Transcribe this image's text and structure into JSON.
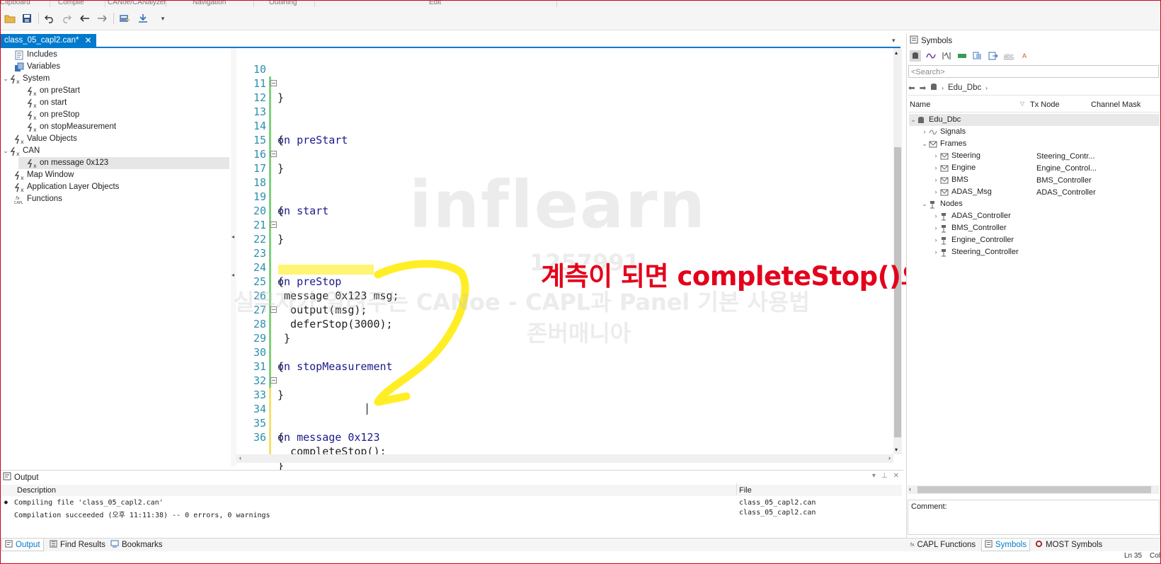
{
  "ribbon": {
    "groups": [
      "Clipboard",
      "Compile",
      "CANoe/CANalyzer",
      "Navigation",
      "Outlining",
      "Edit"
    ]
  },
  "toolbar": {
    "buttons": [
      "open-folder-icon",
      "save-icon",
      "undo-icon",
      "redo-icon",
      "back-icon",
      "forward-icon",
      "insert-icon",
      "download-icon",
      "overflow-icon"
    ]
  },
  "document_tab": {
    "label": "class_05_capl2.can*",
    "close": "✕"
  },
  "tree": {
    "items": [
      {
        "label": "Includes",
        "icon": "includes-icon"
      },
      {
        "label": "Variables",
        "icon": "variables-icon"
      },
      {
        "label": "System",
        "icon": "function-icon",
        "expanded": true
      },
      {
        "label": "on preStart",
        "icon": "function-icon"
      },
      {
        "label": "on start",
        "icon": "function-icon"
      },
      {
        "label": "on preStop",
        "icon": "function-icon"
      },
      {
        "label": "on stopMeasurement",
        "icon": "function-icon"
      },
      {
        "label": "Value Objects",
        "icon": "function-icon"
      },
      {
        "label": "CAN",
        "icon": "function-icon",
        "expanded": true
      },
      {
        "label": "on message 0x123",
        "icon": "function-icon",
        "selected": true
      },
      {
        "label": "Map Window",
        "icon": "function-icon"
      },
      {
        "label": "Application Layer Objects",
        "icon": "function-icon"
      },
      {
        "label": "Functions",
        "icon": "capl-icon"
      }
    ]
  },
  "editor": {
    "lines": [
      {
        "n": "10",
        "text": "}"
      },
      {
        "n": "11",
        "text": ""
      },
      {
        "n": "12",
        "text": "on preStart"
      },
      {
        "n": "13",
        "text": "{"
      },
      {
        "n": "14",
        "text": ""
      },
      {
        "n": "15",
        "text": "}"
      },
      {
        "n": "16",
        "text": ""
      },
      {
        "n": "17",
        "text": "on start"
      },
      {
        "n": "18",
        "text": "{"
      },
      {
        "n": "19",
        "text": ""
      },
      {
        "n": "20",
        "text": "}"
      },
      {
        "n": "21",
        "text": ""
      },
      {
        "n": "22",
        "text": "on preStop"
      },
      {
        "n": "23",
        "text": "{"
      },
      {
        "n": "24",
        "text": " message 0x123 msg;"
      },
      {
        "n": "25",
        "text": "  output(msg);"
      },
      {
        "n": "26",
        "text": "  deferStop(3000);"
      },
      {
        "n": "27",
        "text": " }"
      },
      {
        "n": "28",
        "text": "on stopMeasurement"
      },
      {
        "n": "29",
        "text": "{"
      },
      {
        "n": "30",
        "text": ""
      },
      {
        "n": "31",
        "text": "}"
      },
      {
        "n": "32",
        "text": ""
      },
      {
        "n": "33",
        "text": "on message 0x123"
      },
      {
        "n": "34",
        "text": "{"
      },
      {
        "n": "35",
        "text": "  completeStop();"
      },
      {
        "n": "36",
        "text": "}"
      }
    ],
    "cursor_line": "35"
  },
  "watermark": {
    "logo": "inflearn",
    "line1": "1257991",
    "line2": "실무자가 알려주는 CANoe - CAPL과 Panel 기본 사용법",
    "line3": "존버매니아"
  },
  "annotation": {
    "text": "계측이 되면 completeStop()으로 멈추기",
    "color": "#e3001b"
  },
  "symbols": {
    "title": "Symbols",
    "search_placeholder": "<Search>",
    "breadcrumb": "Edu_Dbc",
    "columns": [
      "Name",
      "Tx Node",
      "Channel Mask"
    ],
    "tree": [
      {
        "label": "Edu_Dbc",
        "tx": ""
      },
      {
        "label": "Signals",
        "tx": ""
      },
      {
        "label": "Frames",
        "tx": ""
      },
      {
        "label": "Steering",
        "tx": "Steering_Contr..."
      },
      {
        "label": "Engine",
        "tx": "Engine_Control..."
      },
      {
        "label": "BMS",
        "tx": "BMS_Controller"
      },
      {
        "label": "ADAS_Msg",
        "tx": "ADAS_Controller"
      },
      {
        "label": "Nodes",
        "tx": ""
      },
      {
        "label": "ADAS_Controller",
        "tx": ""
      },
      {
        "label": "BMS_Controller",
        "tx": ""
      },
      {
        "label": "Engine_Controller",
        "tx": ""
      },
      {
        "label": "Steering_Controller",
        "tx": ""
      }
    ],
    "comment_label": "Comment:"
  },
  "output": {
    "title": "Output",
    "columns": [
      "Description",
      "File"
    ],
    "rows": [
      {
        "desc": "Compiling file 'class_05_capl2.can'",
        "file": "class_05_capl2.can"
      },
      {
        "desc": "Compilation succeeded (오후 11:11:38) -- 0 errors, 0 warnings",
        "file": "class_05_capl2.can"
      }
    ]
  },
  "bottom_tabs": {
    "left": [
      "Output",
      "Find Results",
      "Bookmarks"
    ],
    "right": [
      "CAPL Functions",
      "Symbols",
      "MOST Symbols"
    ]
  },
  "status": {
    "ln": "Ln 35",
    "col": "Col"
  },
  "colors": {
    "accent": "#007acc",
    "keyword": "#1a1a8c",
    "line_number": "#2b91af",
    "highlight": "#fff200"
  }
}
